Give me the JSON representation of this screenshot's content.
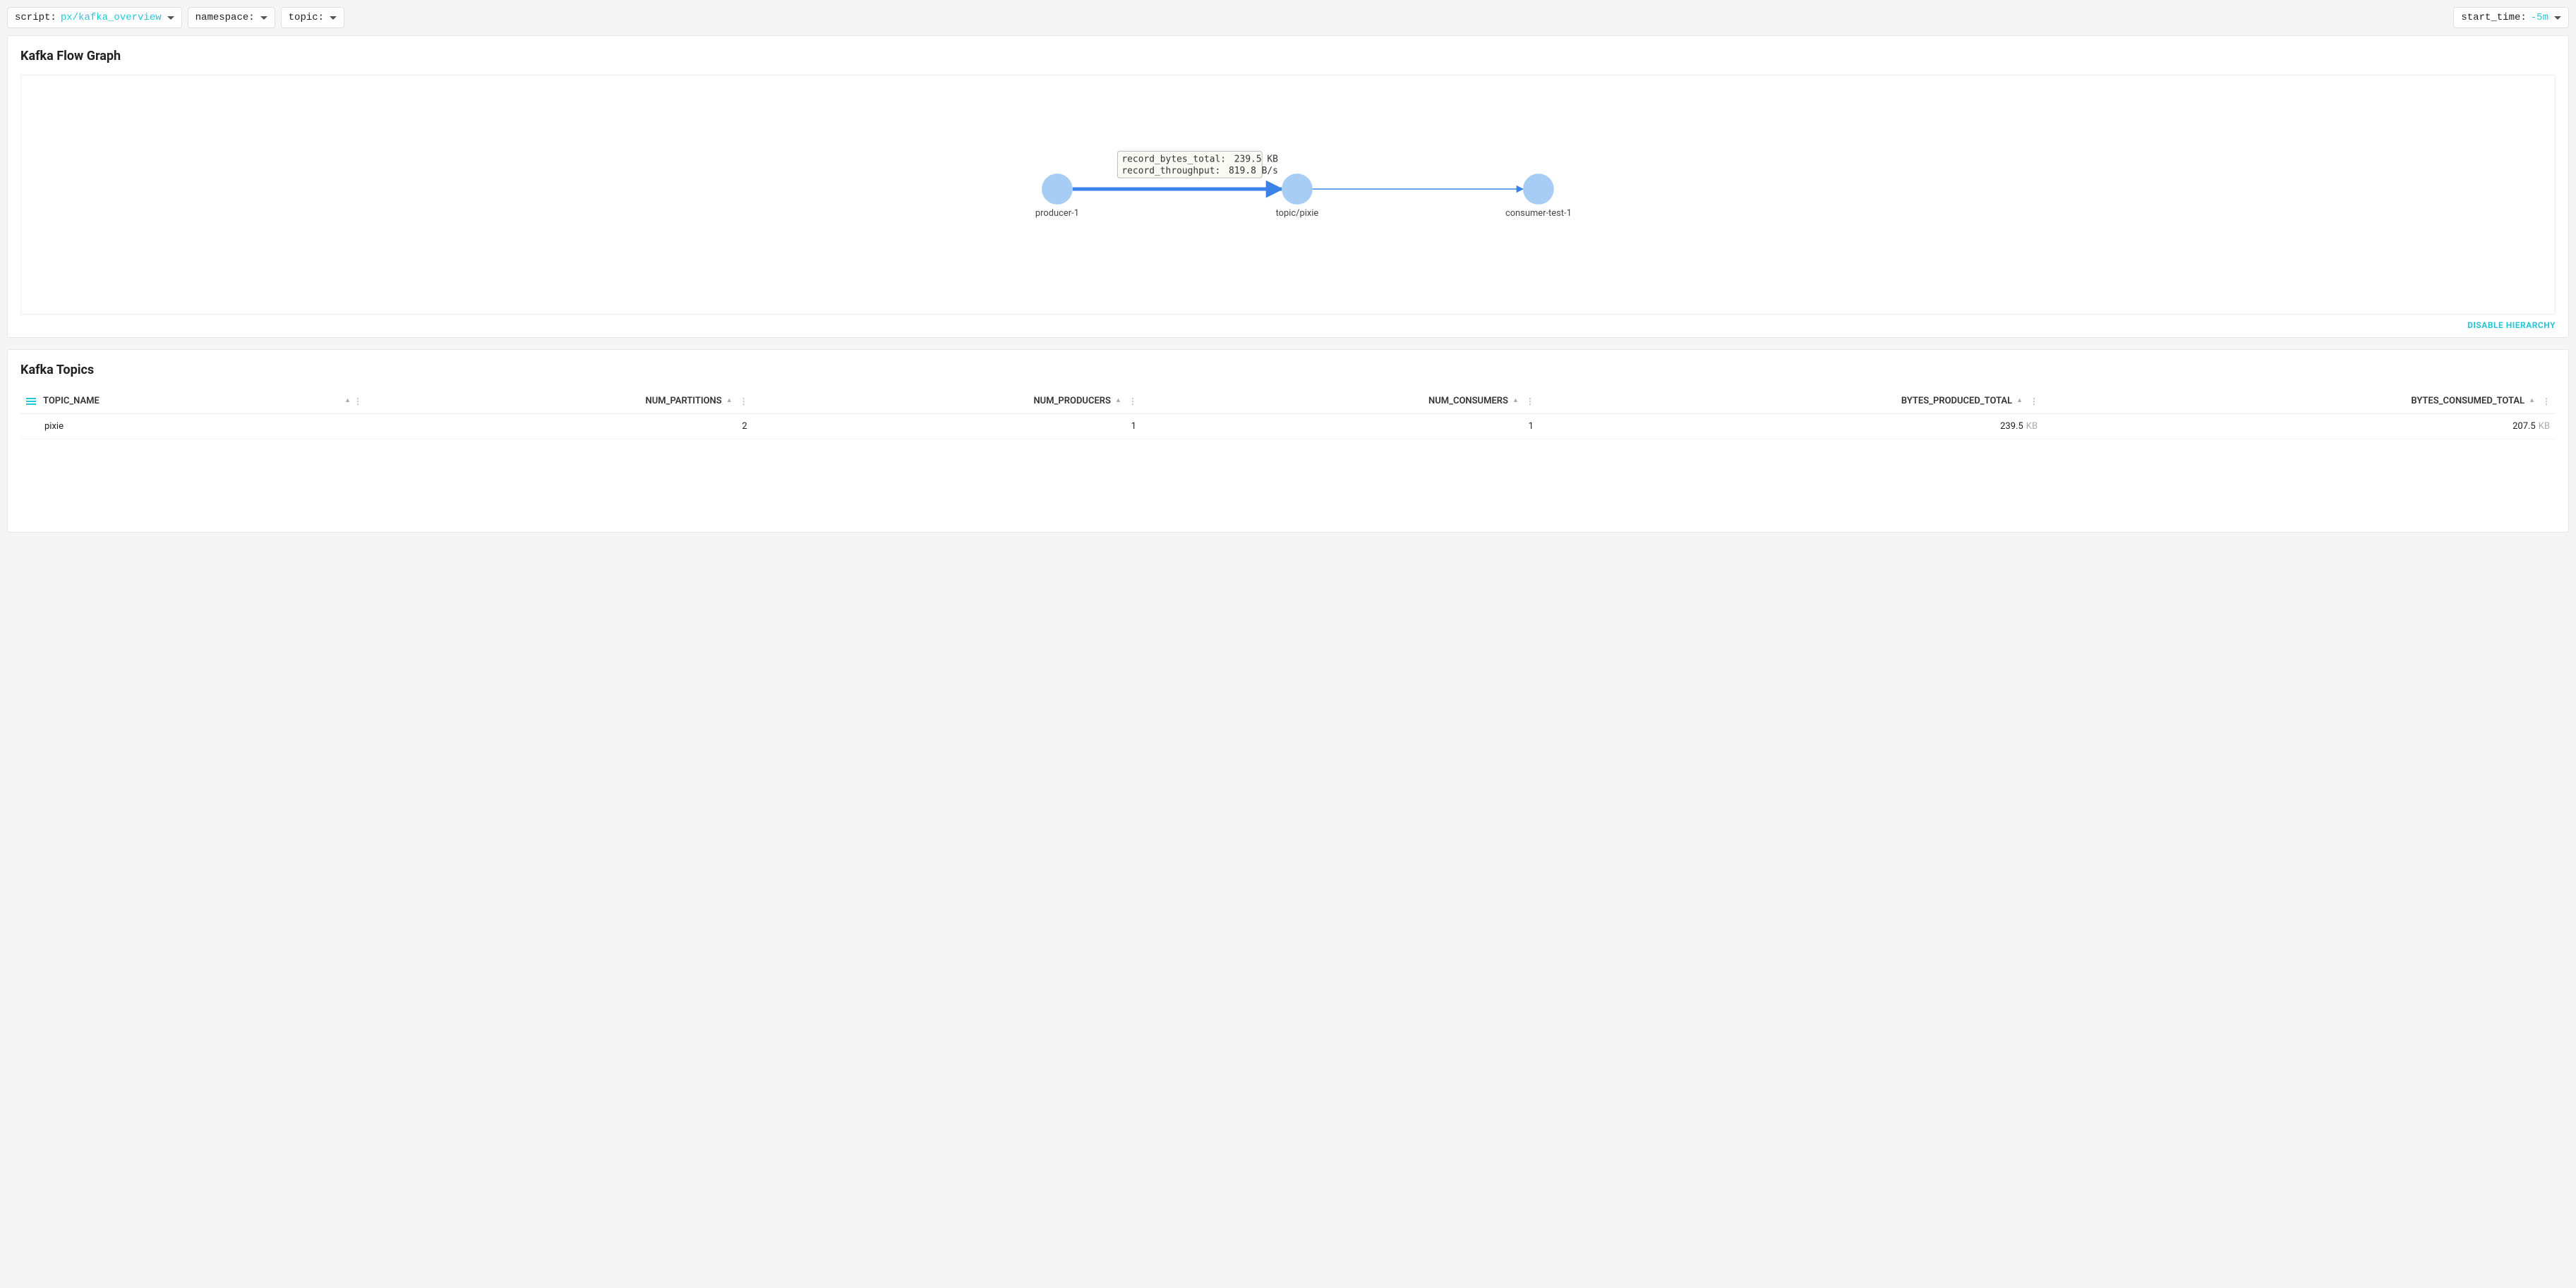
{
  "topbar": {
    "script_label": "script:",
    "script_value": "px/kafka_overview",
    "namespace_label": "namespace:",
    "topic_label": "topic:",
    "start_time_label": "start_time:",
    "start_time_value": "-5m"
  },
  "flow_graph": {
    "title": "Kafka Flow Graph",
    "disable_hierarchy_label": "DISABLE HIERARCHY",
    "nodes": [
      {
        "id": "producer-1",
        "label": "producer-1"
      },
      {
        "id": "topic-pixie",
        "label": "topic/pixie"
      },
      {
        "id": "consumer-test-1",
        "label": "consumer-test-1"
      }
    ],
    "tooltip": {
      "line1_key": "record_bytes_total:",
      "line1_val": "239.5 KB",
      "line2_key": "record_throughput:",
      "line2_val": "819.8  B/s"
    }
  },
  "topics_table": {
    "title": "Kafka Topics",
    "columns": [
      "TOPIC_NAME",
      "NUM_PARTITIONS",
      "NUM_PRODUCERS",
      "NUM_CONSUMERS",
      "BYTES_PRODUCED_TOTAL",
      "BYTES_CONSUMED_TOTAL"
    ],
    "rows": [
      {
        "topic_name": "pixie",
        "num_partitions": "2",
        "num_producers": "1",
        "num_consumers": "1",
        "bytes_produced_total": "239.5",
        "bytes_produced_unit": "KB",
        "bytes_consumed_total": "207.5",
        "bytes_consumed_unit": "KB"
      }
    ]
  }
}
